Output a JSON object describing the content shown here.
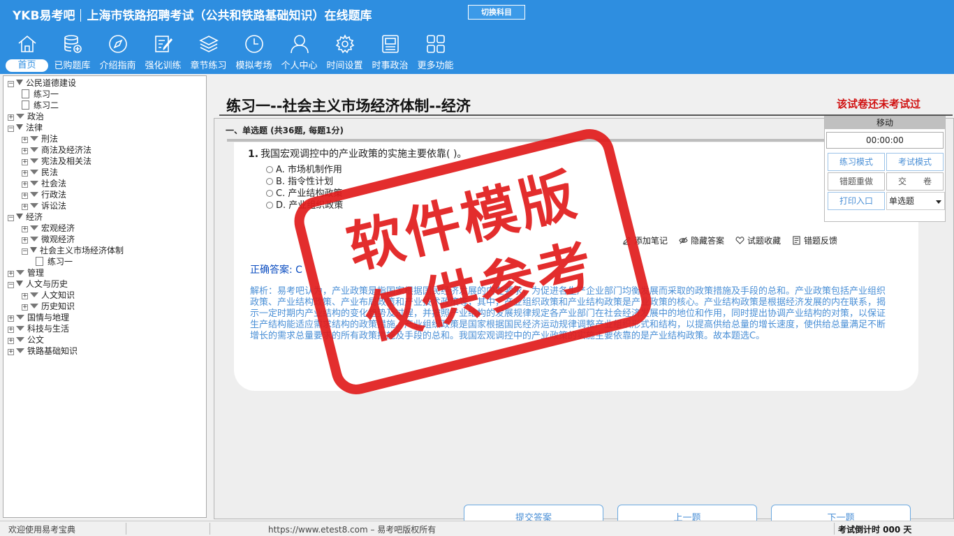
{
  "app": {
    "brand": "YKB易考吧",
    "title": "上海市铁路招聘考试（公共和铁路基础知识）在线题库",
    "switch_subject": "切换科目"
  },
  "nav": [
    {
      "label": "首页",
      "icon": "home-icon"
    },
    {
      "label": "已购题库",
      "icon": "database-icon"
    },
    {
      "label": "介绍指南",
      "icon": "compass-icon"
    },
    {
      "label": "强化训练",
      "icon": "edit-icon"
    },
    {
      "label": "章节练习",
      "icon": "layers-icon"
    },
    {
      "label": "模拟考场",
      "icon": "clock-icon"
    },
    {
      "label": "个人中心",
      "icon": "user-icon"
    },
    {
      "label": "时间设置",
      "icon": "gear-icon"
    },
    {
      "label": "时事政治",
      "icon": "news-icon"
    },
    {
      "label": "更多功能",
      "icon": "grid-icon"
    }
  ],
  "tree": [
    {
      "label": "公民道德建设",
      "level": 0,
      "state": "open"
    },
    {
      "label": "练习一",
      "level": 1,
      "state": "doc"
    },
    {
      "label": "练习二",
      "level": 1,
      "state": "doc"
    },
    {
      "label": "政治",
      "level": 0,
      "state": "closed"
    },
    {
      "label": "法律",
      "level": 0,
      "state": "open"
    },
    {
      "label": "刑法",
      "level": 1,
      "state": "closed"
    },
    {
      "label": "商法及经济法",
      "level": 1,
      "state": "closed"
    },
    {
      "label": "宪法及相关法",
      "level": 1,
      "state": "closed"
    },
    {
      "label": "民法",
      "level": 1,
      "state": "closed"
    },
    {
      "label": "社会法",
      "level": 1,
      "state": "closed"
    },
    {
      "label": "行政法",
      "level": 1,
      "state": "closed"
    },
    {
      "label": "诉讼法",
      "level": 1,
      "state": "closed"
    },
    {
      "label": "经济",
      "level": 0,
      "state": "open"
    },
    {
      "label": "宏观经济",
      "level": 1,
      "state": "closed"
    },
    {
      "label": "微观经济",
      "level": 1,
      "state": "closed"
    },
    {
      "label": "社会主义市场经济体制",
      "level": 1,
      "state": "open"
    },
    {
      "label": "练习一",
      "level": 2,
      "state": "doc"
    },
    {
      "label": "管理",
      "level": 0,
      "state": "closed"
    },
    {
      "label": "人文与历史",
      "level": 0,
      "state": "open"
    },
    {
      "label": "人文知识",
      "level": 1,
      "state": "closed"
    },
    {
      "label": "历史知识",
      "level": 1,
      "state": "closed"
    },
    {
      "label": "国情与地理",
      "level": 0,
      "state": "closed"
    },
    {
      "label": "科技与生活",
      "level": 0,
      "state": "closed"
    },
    {
      "label": "公文",
      "level": 0,
      "state": "closed"
    },
    {
      "label": "铁路基础知识",
      "level": 0,
      "state": "closed"
    }
  ],
  "paper": {
    "title": "练习一--社会主义市场经济体制--经济",
    "status": "该试卷还未考试过",
    "section": "一、单选题 (共36题, 每题1分)"
  },
  "question": {
    "number": "1.",
    "text": "我国宏观调控中的产业政策的实施主要依靠( )。",
    "options": [
      "A. 市场机制作用",
      "B. 指令性计划",
      "C. 产业结构政策",
      "D. 产业组织政策"
    ],
    "tools": [
      "添加笔记",
      "隐藏答案",
      "试题收藏",
      "错题反馈"
    ],
    "answer": "正确答案: C",
    "analysis": "解析：易考吧认为，产业政策是指国家根据国民经济发展的内在要求，为促进各生产企业部门均衡发展而采取的政策措施及手段的总和。产业政策包括产业组织政策、产业结构政策、产业布局政策和产业技术政策等，其中，产业组织政策和产业结构政策是产业政策的核心。产业结构政策是根据经济发展的内在联系，揭示一定时期内产业结构的变化趋势及过程，并按照产业结构的发展规律规定各产业部门在社会经济发展中的地位和作用，同时提出协调产业结构的对策，以保证生产结构能适应需求结构的政策措施。产业组织政策是国家根据国民经济运动规律调整产业组织形式和结构，以提高供给总量的增长速度，使供给总量满足不断增长的需求总量要求的所有政策措施及手段的总和。我国宏观调控中的产业政策的实施主要依靠的是产业结构政策。故本题选C。"
  },
  "buttons": {
    "submit": "提交答案",
    "prev": "上一题",
    "next": "下一题"
  },
  "panel": {
    "title": "移动",
    "timer": "00:00:00",
    "practice_mode": "练习模式",
    "exam_mode": "考试模式",
    "redo_wrong": "错题重做",
    "submit_paper": "交　　卷",
    "print": "打印入口",
    "question_type": "单选题"
  },
  "stamp": {
    "line1": "软件模版",
    "line2": "仅供参考"
  },
  "status": {
    "welcome": "欢迎使用易考宝典",
    "copyright": "https://www.etest8.com – 易考吧版权所有",
    "countdown": "考试倒计时 000 天"
  },
  "colors": {
    "header": "#2e8ee0",
    "accent_red": "#d01010",
    "link_blue": "#4a8fd6"
  }
}
